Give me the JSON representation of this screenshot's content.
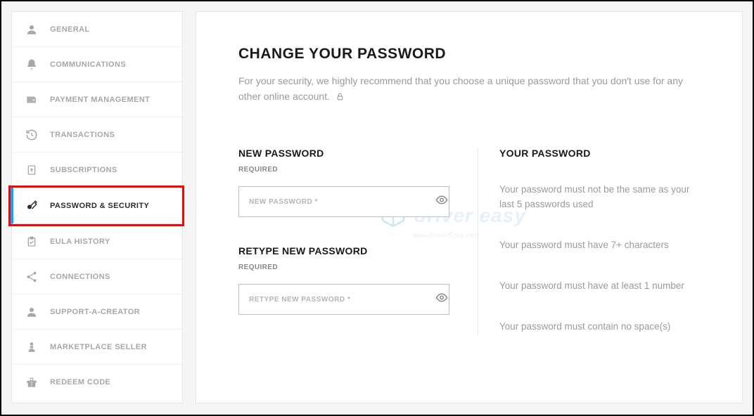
{
  "sidebar": {
    "items": [
      {
        "id": "general",
        "label": "GENERAL"
      },
      {
        "id": "communications",
        "label": "COMMUNICATIONS"
      },
      {
        "id": "payment-management",
        "label": "PAYMENT MANAGEMENT"
      },
      {
        "id": "transactions",
        "label": "TRANSACTIONS"
      },
      {
        "id": "subscriptions",
        "label": "SUBSCRIPTIONS"
      },
      {
        "id": "password-security",
        "label": "PASSWORD & SECURITY",
        "active": true
      },
      {
        "id": "eula-history",
        "label": "EULA HISTORY"
      },
      {
        "id": "connections",
        "label": "CONNECTIONS"
      },
      {
        "id": "support-a-creator",
        "label": "SUPPORT-A-CREATOR"
      },
      {
        "id": "marketplace-seller",
        "label": "MARKETPLACE SELLER"
      },
      {
        "id": "redeem-code",
        "label": "REDEEM CODE"
      }
    ]
  },
  "page": {
    "title": "CHANGE YOUR PASSWORD",
    "description": "For your security, we highly recommend that you choose a unique password that you don't use for any other online account."
  },
  "form": {
    "new_password": {
      "label": "NEW PASSWORD",
      "required_text": "REQUIRED",
      "placeholder": "NEW PASSWORD *",
      "value": ""
    },
    "retype_password": {
      "label": "RETYPE NEW PASSWORD",
      "required_text": "REQUIRED",
      "placeholder": "RETYPE NEW PASSWORD *",
      "value": ""
    }
  },
  "rules": {
    "heading": "YOUR PASSWORD",
    "items": [
      "Your password must not be the same as your last 5 passwords used",
      "Your password must have 7+ characters",
      "Your password must have at least 1 number",
      "Your password must contain no space(s)"
    ]
  },
  "watermark": {
    "brand": "driver easy",
    "url": "www.DriverEasy.com"
  }
}
